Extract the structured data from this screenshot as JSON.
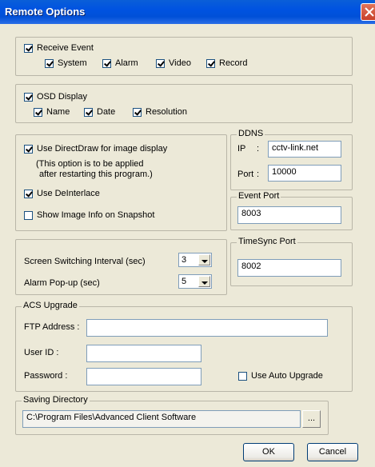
{
  "window": {
    "title": "Remote Options"
  },
  "receive_event": {
    "label": "Receive Event",
    "checked": true,
    "options": [
      {
        "label": "System",
        "checked": true
      },
      {
        "label": "Alarm",
        "checked": true
      },
      {
        "label": "Video",
        "checked": true
      },
      {
        "label": "Record",
        "checked": true
      }
    ]
  },
  "osd": {
    "label": "OSD Display",
    "checked": true,
    "options": [
      {
        "label": "Name",
        "checked": true
      },
      {
        "label": "Date",
        "checked": true
      },
      {
        "label": "Resolution",
        "checked": true
      }
    ]
  },
  "display": {
    "directdraw_label": "Use DirectDraw for image display",
    "directdraw_checked": true,
    "note_line1": "(This option is to be applied",
    "note_line2": "after restarting this program.)",
    "deinterlace_label": "Use DeInterlace",
    "deinterlace_checked": true,
    "image_info_label": "Show Image Info on Snapshot",
    "image_info_checked": false
  },
  "ddns": {
    "title": "DDNS",
    "ip_label": "IP",
    "ip_colon": ":",
    "ip_value": "cctv-link.net",
    "port_label": "Port",
    "port_colon": ":",
    "port_value": "10000"
  },
  "event_port": {
    "title": "Event Port",
    "value": "8003"
  },
  "timesync_port": {
    "title": "TimeSync Port",
    "value": "8002"
  },
  "intervals": {
    "switching_label": "Screen Switching Interval (sec)",
    "switching_value": "3",
    "alarm_label": "Alarm Pop-up (sec)",
    "alarm_value": "5"
  },
  "acs_upgrade": {
    "title": "ACS Upgrade",
    "ftp_label": "FTP Address :",
    "ftp_value": "",
    "user_label": "User ID :",
    "user_value": "",
    "password_label": "Password :",
    "password_value": "",
    "auto_upgrade_label": "Use Auto Upgrade",
    "auto_upgrade_checked": false
  },
  "saving_directory": {
    "title": "Saving Directory",
    "path": "C:\\Program Files\\Advanced Client Software",
    "browse_label": "..."
  },
  "buttons": {
    "ok": "OK",
    "cancel": "Cancel"
  }
}
